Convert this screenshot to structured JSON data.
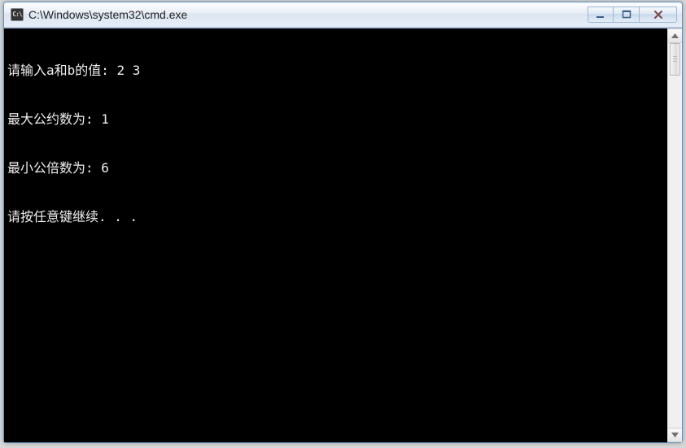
{
  "window": {
    "title": "C:\\Windows\\system32\\cmd.exe",
    "icon_label": "C:\\"
  },
  "console": {
    "lines": [
      "请输入a和b的值: 2 3",
      "最大公约数为: 1",
      "最小公倍数为: 6",
      "请按任意键继续. . ."
    ]
  }
}
